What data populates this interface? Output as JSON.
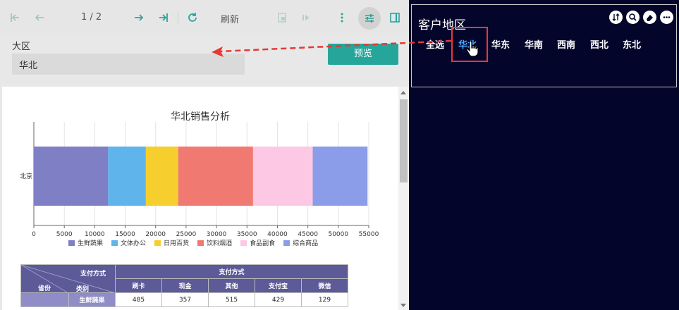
{
  "toolbar": {
    "page_indicator": "1 / 2",
    "refresh_label": "刷新"
  },
  "params": {
    "region_label": "大区",
    "region_value": "华北",
    "preview_label": "预览"
  },
  "filter": {
    "title": "客户地区",
    "items": [
      "全选",
      "华北",
      "华东",
      "华南",
      "西南",
      "西北",
      "东北"
    ],
    "selected": "华北",
    "accent_color": "#4ea8ff",
    "highlight_color": "#e53935"
  },
  "chart_data": {
    "type": "bar",
    "orientation": "horizontal",
    "stacked": true,
    "title": "华北销售分析",
    "categories": [
      "北京"
    ],
    "series": [
      {
        "name": "生鲜蔬果",
        "values": [
          12200
        ],
        "color": "#7f7fc6"
      },
      {
        "name": "文体办公",
        "values": [
          6200
        ],
        "color": "#5fb4ec"
      },
      {
        "name": "日用百货",
        "values": [
          5300
        ],
        "color": "#f6ce2e"
      },
      {
        "name": "饮料烟酒",
        "values": [
          12300
        ],
        "color": "#f07a71"
      },
      {
        "name": "食品副食",
        "values": [
          9800
        ],
        "color": "#fcc8e4"
      },
      {
        "name": "综合商品",
        "values": [
          9000
        ],
        "color": "#8b9ce8"
      }
    ],
    "xlim": [
      0,
      55000
    ],
    "xticks": [
      "0",
      "5000",
      "10000",
      "15000",
      "20000",
      "25000",
      "30000",
      "35000",
      "40000",
      "45000",
      "50000",
      "55000"
    ],
    "legend": "bottom",
    "grid": true
  },
  "table": {
    "corner_top": "支付方式",
    "corner_left": "省份",
    "corner_mid": "类别",
    "group_header": "支付方式",
    "columns": [
      "刷卡",
      "现金",
      "其他",
      "支付宝",
      "微信"
    ],
    "rows": [
      {
        "category": "生鲜蔬果",
        "values": [
          "485",
          "357",
          "515",
          "429",
          "129"
        ]
      }
    ]
  }
}
